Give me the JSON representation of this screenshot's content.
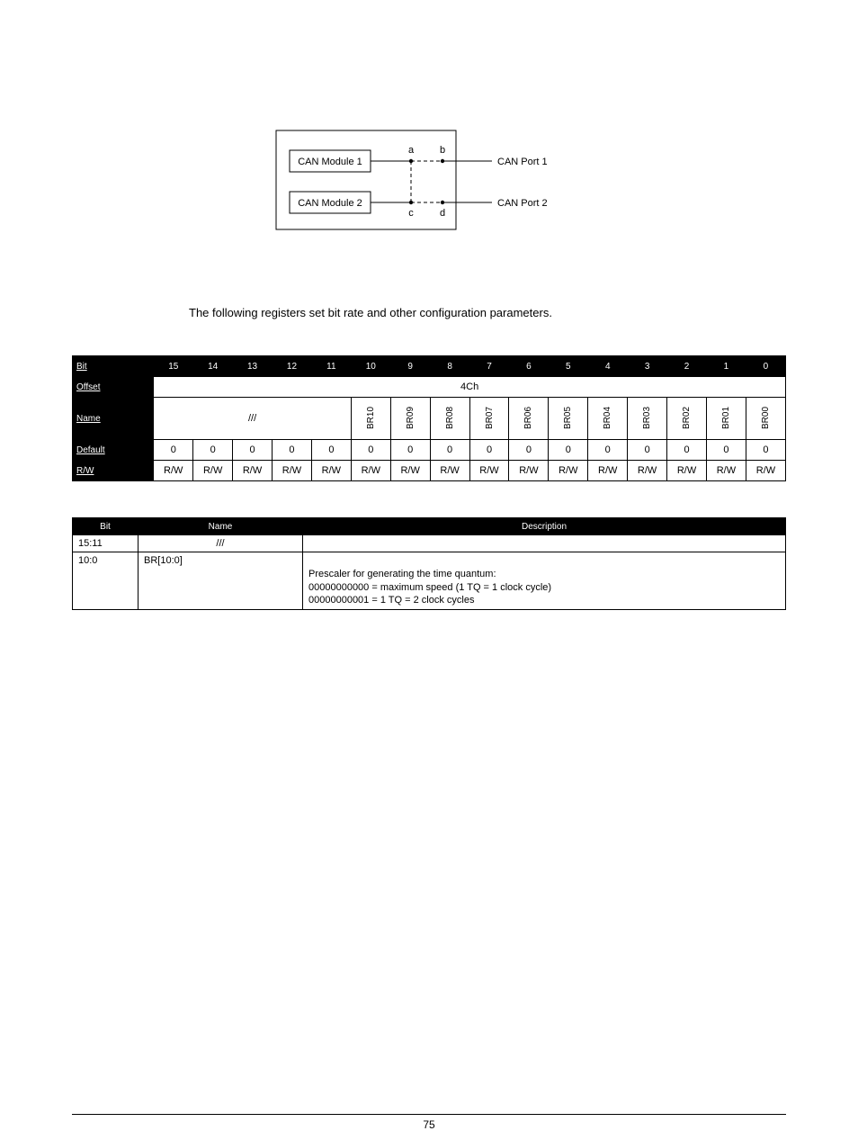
{
  "figure": {
    "module1": "CAN Module 1",
    "module2": "CAN Module 2",
    "port1": "CAN Port 1",
    "port2": "CAN Port 2",
    "a": "a",
    "b": "b",
    "c": "c",
    "d": "d"
  },
  "intro": "The following registers set bit rate and other configuration parameters.",
  "register": {
    "row_label_bit": "Bit",
    "row_label_offset": "Offset",
    "row_label_name": "Name",
    "row_label_default": "Default",
    "row_label_rw": "R/W",
    "offset": "4Ch",
    "bits": [
      "15",
      "14",
      "13",
      "12",
      "11",
      "10",
      "9",
      "8",
      "7",
      "6",
      "5",
      "4",
      "3",
      "2",
      "1",
      "0"
    ],
    "names_reserved": "///",
    "names": [
      "BR10",
      "BR09",
      "BR08",
      "BR07",
      "BR06",
      "BR05",
      "BR04",
      "BR03",
      "BR02",
      "BR01",
      "BR00"
    ],
    "defaults": [
      "0",
      "0",
      "0",
      "0",
      "0",
      "0",
      "0",
      "0",
      "0",
      "0",
      "0",
      "0",
      "0",
      "0",
      "0",
      "0"
    ],
    "rw": [
      "R/W",
      "R/W",
      "R/W",
      "R/W",
      "R/W",
      "R/W",
      "R/W",
      "R/W",
      "R/W",
      "R/W",
      "R/W",
      "R/W",
      "R/W",
      "R/W",
      "R/W",
      "R/W"
    ]
  },
  "desc": {
    "head_bit": "Bit",
    "head_name": "Name",
    "head_description": "Description",
    "rows": [
      {
        "bit": "15:11",
        "name": "///",
        "description": ""
      },
      {
        "bit": "10:0",
        "name": "BR[10:0]",
        "d1": "Prescaler for generating the time quantum:",
        "d2": "00000000000 = maximum speed (1 TQ = 1 clock cycle)",
        "d3": "00000000001 = 1 TQ = 2 clock cycles"
      }
    ]
  },
  "page_number": "75"
}
